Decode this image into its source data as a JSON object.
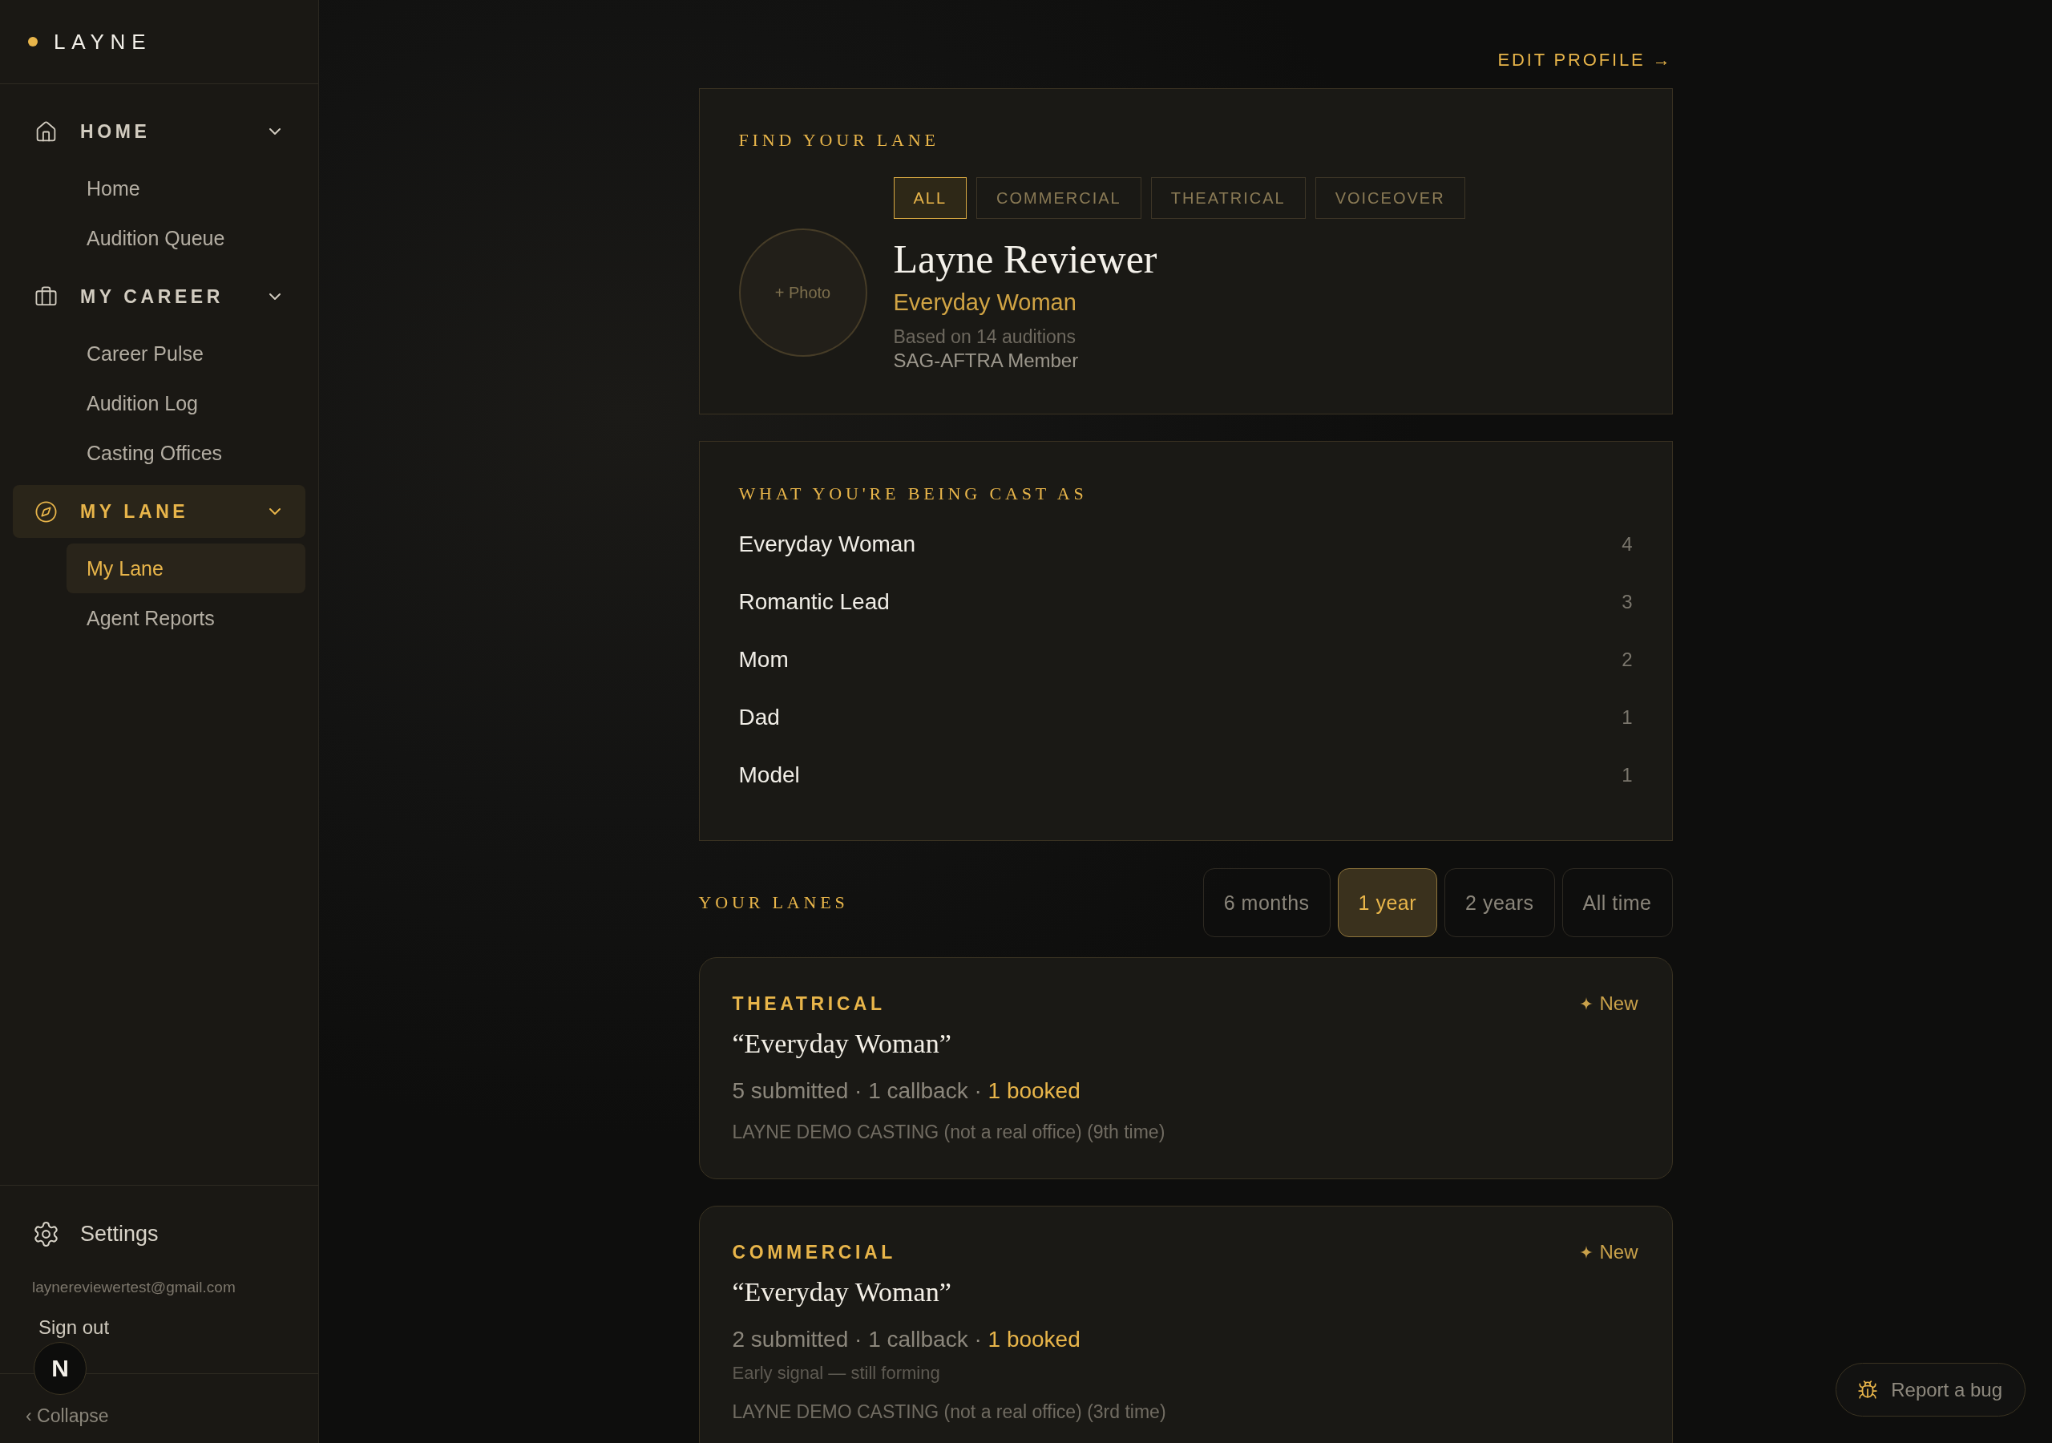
{
  "sidebar": {
    "brand": "LAYNE",
    "groups": [
      {
        "label": "HOME",
        "expanded": true,
        "selected": false,
        "items": [
          {
            "label": "Home",
            "selected": false
          },
          {
            "label": "Audition Queue",
            "selected": false
          }
        ]
      },
      {
        "label": "MY CAREER",
        "expanded": true,
        "selected": false,
        "items": [
          {
            "label": "Career Pulse",
            "selected": false
          },
          {
            "label": "Audition Log",
            "selected": false
          },
          {
            "label": "Casting Offices",
            "selected": false
          }
        ]
      },
      {
        "label": "MY LANE",
        "expanded": true,
        "selected": true,
        "items": [
          {
            "label": "My Lane",
            "selected": true
          },
          {
            "label": "Agent Reports",
            "selected": false
          }
        ]
      }
    ],
    "settings": "Settings",
    "email": "laynereviewertest@gmail.com",
    "sign_out": "Sign out",
    "collapse": "‹ Collapse"
  },
  "edit_profile": "EDIT PROFILE →",
  "profile_card": {
    "title": "FIND YOUR LANE",
    "filters": [
      {
        "label": "ALL",
        "selected": true
      },
      {
        "label": "COMMERCIAL",
        "selected": false
      },
      {
        "label": "THEATRICAL",
        "selected": false
      },
      {
        "label": "VOICEOVER",
        "selected": false
      }
    ],
    "photo_label": "+ Photo",
    "name": "Layne Reviewer",
    "lane": "Everyday Woman",
    "basis": "Based on 14 auditions",
    "membership": "SAG-AFTRA Member"
  },
  "cast_card": {
    "title": "WHAT YOU'RE BEING CAST AS",
    "rows": [
      {
        "label": "Everyday Woman",
        "count": "4"
      },
      {
        "label": "Romantic Lead",
        "count": "3"
      },
      {
        "label": "Mom",
        "count": "2"
      },
      {
        "label": "Dad",
        "count": "1"
      },
      {
        "label": "Model",
        "count": "1"
      }
    ]
  },
  "lanes": {
    "title": "YOUR LANES",
    "ranges": [
      {
        "label": "6 months",
        "selected": false
      },
      {
        "label": "1 year",
        "selected": true
      },
      {
        "label": "2 years",
        "selected": false
      },
      {
        "label": "All time",
        "selected": false
      }
    ],
    "cards": [
      {
        "category": "THEATRICAL",
        "badge": "New",
        "title": "“Everyday Woman”",
        "summary": "5 submitted · 1 callback ·",
        "booked": "1 booked",
        "office": "LAYNE DEMO CASTING (not a real office) (9th time)"
      },
      {
        "category": "COMMERCIAL",
        "badge": "New",
        "title": "“Everyday Woman”",
        "summary": "2 submitted · 1 callback ·",
        "booked": "1 booked",
        "note": "Early signal — still forming",
        "office": "LAYNE DEMO CASTING (not a real office) (3rd time)"
      }
    ]
  },
  "dev_badge": "N",
  "report_bug": "Report a bug"
}
